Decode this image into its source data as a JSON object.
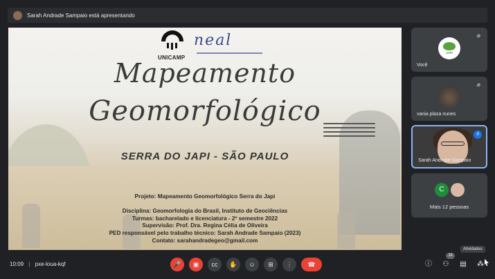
{
  "presenter_banner": "Sarah Andrade Sampaio está apresentando",
  "slide": {
    "logo_left": "UNICAMP",
    "logo_right": "neal",
    "title_line1": "Mapeamento",
    "title_line2": "Geomorfológico",
    "subtitle": "SERRA DO JAPI - SÃO PAULO",
    "info": [
      "Projeto: Mapeamento Geomorfológico Serra do Japi",
      "",
      "Disciplina: Geomorfologia do Brasil, Instituto de Geociências",
      "Turmas: bacharelado e licenciatura - 2º semestre 2022",
      "Supervisão: Prof. Dra. Regina Célia de Oliveira",
      "PED responsável pelo trabalho técnico: Sarah Andrade Sampaio (2023)",
      "Contato: sarahandradegeo@gmail.com"
    ]
  },
  "participants": {
    "you_label": "Você",
    "you_avatar_text": "JAPI",
    "p2_label": "vania plaza nunes",
    "p3_label": "Sarah Andrade Sampaio",
    "more_initial": "C",
    "more_label": "Mais 12 pessoas"
  },
  "bottom": {
    "time": "10:09",
    "separator": "|",
    "meeting_code": "pxe-loua-kqf",
    "people_count": "16",
    "tooltip": "Atividades"
  },
  "colors": {
    "background": "#202124",
    "tile": "#3c4043",
    "end_call": "#ea4335",
    "active_border": "#8ab4f8"
  }
}
